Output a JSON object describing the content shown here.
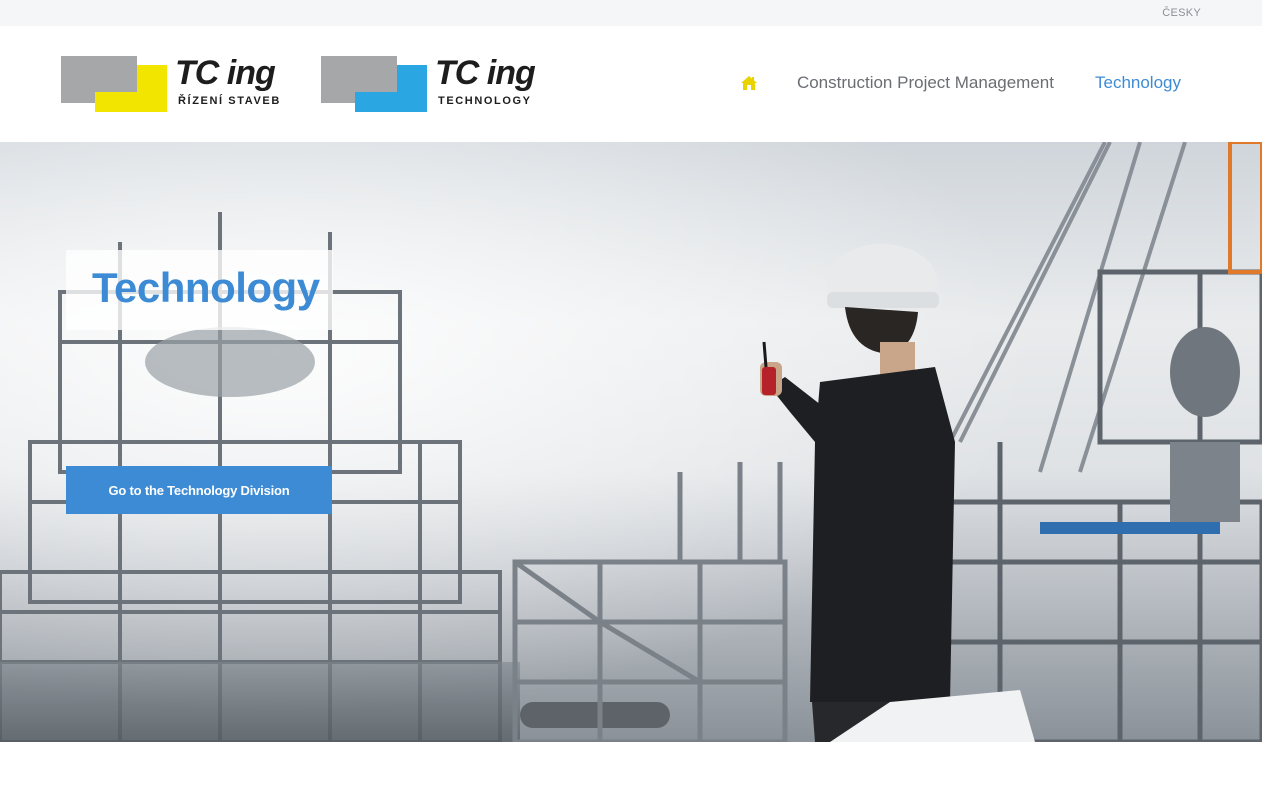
{
  "topbar": {
    "language_link": "ČESKY"
  },
  "logos": [
    {
      "title": "TC ing",
      "subtitle": "ŘÍZENÍ STAVEB",
      "color": "#f2e600"
    },
    {
      "title": "TC ing",
      "subtitle": "TECHNOLOGY",
      "color": "#2aa7e3"
    }
  ],
  "nav": {
    "home_icon": "home-icon",
    "items": [
      {
        "label": "Construction Project Management",
        "active": false
      },
      {
        "label": "Technology",
        "active": true
      }
    ]
  },
  "hero": {
    "title": "Technology",
    "button_label": "Go to the Technology Division",
    "image": "engineer-at-industrial-plant-photo"
  },
  "colors": {
    "accent": "#3e8bd5",
    "home_icon": "#e8d300",
    "nav_text": "#6a6e73"
  }
}
